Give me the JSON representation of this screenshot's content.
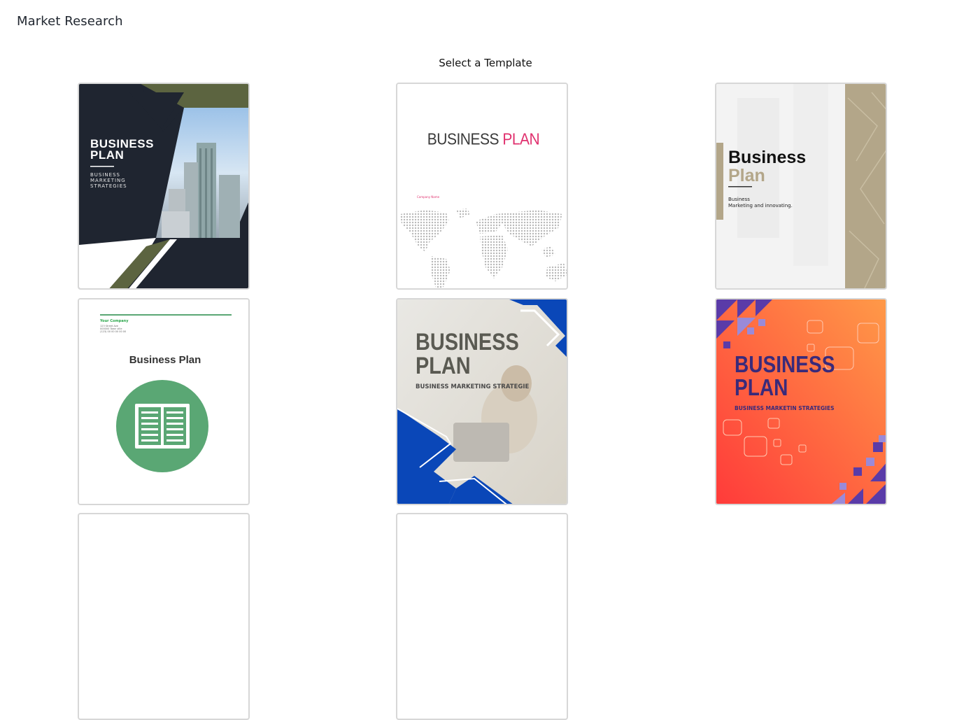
{
  "header": {
    "title": "Market Research"
  },
  "main": {
    "subtitle": "Select a Template"
  },
  "templates": [
    {
      "title_line1": "BUSINESS",
      "title_line2": "PLAN",
      "subtitle": "BUSINESS\nMARKETING\nSTRATEGIES"
    },
    {
      "title_part1": "BUSINESS ",
      "title_part2": "PLAN",
      "company": "Company Name"
    },
    {
      "title_line1": "Business",
      "title_line2": "Plan",
      "subtitle": "Business\nMarketing and innovating."
    },
    {
      "company": "Your Company",
      "address": "123 Street Ave\n000000 Town ville\n(123) 00 00 00 00 00",
      "title": "Business Plan"
    },
    {
      "title": "BUSINESS\nPLAN",
      "subtitle": "BUSINESS MARKETING STRATEGIE"
    },
    {
      "title": "BUSINESS\nPLAN",
      "subtitle": "BUSINESS MARKETIN STRATEGIES"
    }
  ],
  "colors": {
    "navy": "#1f2530",
    "olive": "#5c6440",
    "pink": "#e0306e",
    "tan": "#b3a689",
    "green": "#5aa774",
    "blue": "#0a47b8",
    "orange": "#f57b3a",
    "purple": "#3a2a7a"
  }
}
